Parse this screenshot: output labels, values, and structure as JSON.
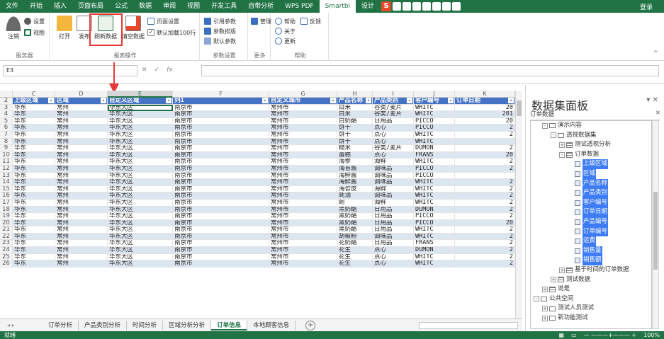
{
  "ribbon_tabs": [
    "文件",
    "开始",
    "插入",
    "页面布局",
    "公式",
    "数据",
    "审阅",
    "视图",
    "开发工具",
    "自带分析",
    "WPS PDF",
    "Smartbi",
    "设计"
  ],
  "active_tab_index": 11,
  "login_label": "登录",
  "ribbon": {
    "server_group": {
      "label": "服务器",
      "logout": "注销",
      "settings": "设置",
      "view": "视图"
    },
    "report_group": {
      "label": "报表操作",
      "open": "打开",
      "publish": "发布",
      "refresh": "刷新数据",
      "clear": "清空数据",
      "page_setup": "页面设置",
      "default_load": "默认加载100行"
    },
    "param_group": {
      "label": "参数设置",
      "ref_param": "引用参数",
      "param_layout": "参数排版",
      "default_param": "默认参数"
    },
    "more_group": {
      "label": "更多",
      "manage": "管理"
    },
    "help_group": {
      "label": "帮助",
      "help": "帮助",
      "feedback": "反馈",
      "about": "关于",
      "update": "更新"
    }
  },
  "namebox": "E3",
  "formula_icons": {
    "cancel": "✕",
    "confirm": "✓",
    "fx": "fx"
  },
  "columns": [
    "C",
    "D",
    "E",
    "F",
    "G",
    "H",
    "I",
    "J",
    "K"
  ],
  "selected_column": "E",
  "table": {
    "header_row_number": "2",
    "headers": [
      "上级区域",
      "区域",
      "自定义区域",
      "列1",
      "自定义城市",
      "产品名称",
      "产品类别",
      "客户编号",
      "订单日期"
    ],
    "rows": [
      {
        "n": "3",
        "c": [
          "华东",
          "常州",
          "华东大区",
          "南京市",
          "常州市",
          "白米",
          "谷类/麦片",
          "WHITC",
          "20"
        ]
      },
      {
        "n": "4",
        "c": [
          "华东",
          "常州",
          "华东大区",
          "南京市",
          "常州市",
          "白米",
          "谷类/麦片",
          "WHITC",
          "201"
        ]
      },
      {
        "n": "5",
        "c": [
          "华东",
          "常州",
          "华东大区",
          "南京市",
          "常州市",
          "白奶酪",
          "日用品",
          "PICCO",
          "20"
        ]
      },
      {
        "n": "6",
        "c": [
          "华东",
          "常州",
          "华东大区",
          "南京市",
          "常州市",
          "饼干",
          "点心",
          "PICCO",
          "2"
        ]
      },
      {
        "n": "7",
        "c": [
          "华东",
          "常州",
          "华东大区",
          "南京市",
          "常州市",
          "饼干",
          "点心",
          "WHITC",
          "2"
        ]
      },
      {
        "n": "8",
        "c": [
          "华东",
          "常州",
          "华东大区",
          "南京市",
          "常州市",
          "饼干",
          "点心",
          "WHITC",
          ""
        ]
      },
      {
        "n": "9",
        "c": [
          "华东",
          "常州",
          "华东大区",
          "南京市",
          "常州市",
          "糙米",
          "谷类/麦片",
          "DUMON",
          "2"
        ]
      },
      {
        "n": "10",
        "c": [
          "华东",
          "常州",
          "华东大区",
          "南京市",
          "常州市",
          "蛋糕",
          "点心",
          "FRANS",
          "20"
        ]
      },
      {
        "n": "11",
        "c": [
          "华东",
          "常州",
          "华东大区",
          "南京市",
          "常州市",
          "海参",
          "海鲜",
          "WHITC",
          "2"
        ]
      },
      {
        "n": "12",
        "c": [
          "华东",
          "常州",
          "华东大区",
          "南京市",
          "常州市",
          "海苔酱",
          "调味品",
          "PICCO",
          "2"
        ]
      },
      {
        "n": "13",
        "c": [
          "华东",
          "常州",
          "华东大区",
          "南京市",
          "常州市",
          "海鲜酱",
          "调味品",
          "PICCO",
          ""
        ]
      },
      {
        "n": "14",
        "c": [
          "华东",
          "常州",
          "华东大区",
          "南京市",
          "常州市",
          "海鲜酱",
          "调味品",
          "WHITC",
          "2"
        ]
      },
      {
        "n": "15",
        "c": [
          "华东",
          "常州",
          "华东大区",
          "南京市",
          "常州市",
          "海哲皮",
          "海鲜",
          "WHITC",
          "2"
        ]
      },
      {
        "n": "16",
        "c": [
          "华东",
          "常州",
          "华东大区",
          "南京市",
          "常州市",
          "蚝油",
          "调味品",
          "WHITC",
          "2"
        ]
      },
      {
        "n": "17",
        "c": [
          "华东",
          "常州",
          "华东大区",
          "南京市",
          "常州市",
          "蚵",
          "海鲜",
          "WHITC",
          "2"
        ]
      },
      {
        "n": "18",
        "c": [
          "华东",
          "常州",
          "华东大区",
          "南京市",
          "常州市",
          "黑奶酪",
          "日用品",
          "DUMON",
          "2"
        ]
      },
      {
        "n": "19",
        "c": [
          "华东",
          "常州",
          "华东大区",
          "南京市",
          "常州市",
          "黑奶酪",
          "日用品",
          "PICCO",
          "2"
        ]
      },
      {
        "n": "20",
        "c": [
          "华东",
          "常州",
          "华东大区",
          "南京市",
          "常州市",
          "黑奶酪",
          "日用品",
          "PICCO",
          "20"
        ]
      },
      {
        "n": "21",
        "c": [
          "华东",
          "常州",
          "华东大区",
          "南京市",
          "常州市",
          "黑奶酪",
          "日用品",
          "WHITC",
          "2"
        ]
      },
      {
        "n": "22",
        "c": [
          "华东",
          "常州",
          "华东大区",
          "南京市",
          "常州市",
          "胡椒粉",
          "调味品",
          "WHITC",
          "2"
        ]
      },
      {
        "n": "23",
        "c": [
          "华东",
          "常州",
          "华东大区",
          "南京市",
          "常州市",
          "花奶酪",
          "日用品",
          "FRANS",
          "2"
        ]
      },
      {
        "n": "24",
        "c": [
          "华东",
          "常州",
          "华东大区",
          "南京市",
          "常州市",
          "花生",
          "点心",
          "DUMON",
          "2"
        ]
      },
      {
        "n": "25",
        "c": [
          "华东",
          "常州",
          "华东大区",
          "南京市",
          "常州市",
          "花生",
          "点心",
          "WHITC",
          "2"
        ]
      },
      {
        "n": "26",
        "c": [
          "华东",
          "常州",
          "华东大区",
          "南京市",
          "常州市",
          "花生",
          "点心",
          "WHITC",
          "2"
        ]
      }
    ]
  },
  "sheet_tabs": [
    "订单分析",
    "产品类别分析",
    "时间分析",
    "区域分析分析",
    "订单信息",
    "本地顾客信息"
  ],
  "active_sheet_index": 4,
  "status": {
    "ready": "就绪",
    "zoom": "100%"
  },
  "pane": {
    "title": "数据集面板",
    "subtitle": "订单数据",
    "tree": [
      {
        "label": "演示内容",
        "indent": 1,
        "kind": "folder",
        "toggle": "-"
      },
      {
        "label": "透视数据集",
        "indent": 2,
        "kind": "folder",
        "toggle": "-"
      },
      {
        "label": "测试透视分析",
        "indent": 3,
        "kind": "table",
        "toggle": "+"
      },
      {
        "label": "订单数据",
        "indent": 3,
        "kind": "table",
        "toggle": "-"
      },
      {
        "label": "上级区域",
        "indent": 4,
        "kind": "field",
        "selected": true
      },
      {
        "label": "区域",
        "indent": 4,
        "kind": "field",
        "selected": true
      },
      {
        "label": "产品名称",
        "indent": 4,
        "kind": "field",
        "selected": true
      },
      {
        "label": "产品类别",
        "indent": 4,
        "kind": "field",
        "selected": true
      },
      {
        "label": "客户编号",
        "indent": 4,
        "kind": "field",
        "selected": true
      },
      {
        "label": "订单日期",
        "indent": 4,
        "kind": "field",
        "selected": true
      },
      {
        "label": "产品编号",
        "indent": 4,
        "kind": "field",
        "selected": true
      },
      {
        "label": "订单编号",
        "indent": 4,
        "kind": "field",
        "selected": true
      },
      {
        "label": "运费",
        "indent": 4,
        "kind": "field",
        "selected": true
      },
      {
        "label": "销售量",
        "indent": 4,
        "kind": "field",
        "selected": true
      },
      {
        "label": "销售额",
        "indent": 4,
        "kind": "field",
        "selected": true
      },
      {
        "label": "基于时间的订单数据",
        "indent": 3,
        "kind": "table",
        "toggle": "+"
      },
      {
        "label": "测试数据",
        "indent": 2,
        "kind": "table",
        "toggle": "+"
      },
      {
        "label": "说是",
        "indent": 1,
        "kind": "table",
        "toggle": "+"
      },
      {
        "label": "公共空间",
        "indent": 0,
        "kind": "folder",
        "toggle": "-"
      },
      {
        "label": "测试人员测试",
        "indent": 1,
        "kind": "folder",
        "toggle": "+"
      },
      {
        "label": "新功能测试",
        "indent": 1,
        "kind": "folder",
        "toggle": "+"
      }
    ]
  },
  "colors": {
    "accent": "#217346",
    "header_blue": "#4472c4",
    "band": "#dce6f1",
    "select_blue": "#3d7cf5",
    "highlight_red": "#e53935"
  }
}
